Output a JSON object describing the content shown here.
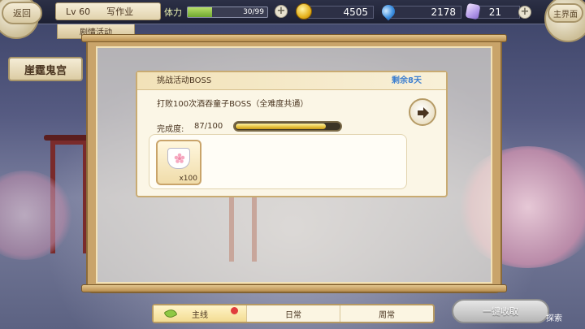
{
  "topbar": {
    "back_label": "返回",
    "level": "Lv 60",
    "player_name": "写作业",
    "subtab": "剧情活动",
    "stamina": {
      "label": "体力",
      "value": "30/99",
      "current": 30,
      "max": 99,
      "icon": "plus-icon"
    },
    "coins": "4505",
    "droplets": "2178",
    "crystals": "21",
    "main_label": "主界面"
  },
  "area": {
    "name": "崖霆鬼宫"
  },
  "quest": {
    "header": "挑战活动BOSS",
    "remaining": "剩余8天",
    "description": "打败100次酒吞童子BOSS（全难度共通）",
    "progress_label": "完成度:",
    "progress_text": "87/100",
    "progress_current": 87,
    "progress_max": 100,
    "reward_qty": "x100",
    "reward_icon": "sakura-token-icon",
    "go_icon": "arrow-right-icon"
  },
  "tabs": [
    {
      "label": "主线",
      "active": true
    },
    {
      "label": "日常",
      "active": false
    },
    {
      "label": "周常",
      "active": false
    }
  ],
  "claim_all": "一键收取",
  "explore_label": "探索",
  "colors": {
    "frame": "#c9a46a",
    "remain": "#3d7fd0",
    "progress_fill": "#e7c23e",
    "stamina_fill": "#6fa830"
  }
}
